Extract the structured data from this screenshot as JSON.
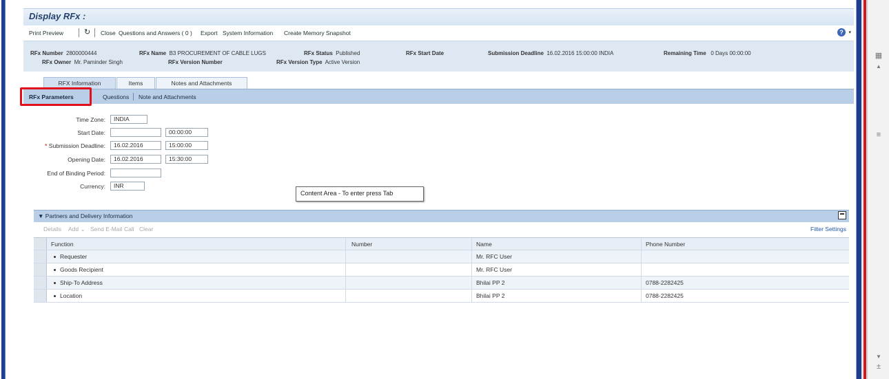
{
  "title": "Display RFx :",
  "toolbar": {
    "print_preview": "Print Preview",
    "refresh_icon": "refresh-icon",
    "close": "Close",
    "questions_answers": "Questions and Answers ( 0 )",
    "export": "Export",
    "system_information": "System Information",
    "create_memory_snapshot": "Create Memory Snapshot",
    "help_icon": "help-icon"
  },
  "header": {
    "rfx_number_label": "RFx Number",
    "rfx_number_value": "2800000444",
    "rfx_name_label": "RFx Name",
    "rfx_name_value": "B3 PROCUREMENT OF CABLE LUGS",
    "rfx_status_label": "RFx Status",
    "rfx_status_value": "Published",
    "rfx_start_date_label": "RFx Start Date",
    "submission_deadline_label": "Submission Deadline",
    "submission_deadline_value": "16.02.2016 15:00:00 INDIA",
    "remaining_time_label": "Remaining Time",
    "remaining_time_value": "0 Days 00:00:00",
    "rfx_owner_label": "RFx Owner",
    "rfx_owner_value": "Mr. Paminder Singh",
    "rfx_version_number_label": "RFx Version Number",
    "rfx_version_type_label": "RFx Version Type",
    "rfx_version_type_value": "Active Version"
  },
  "main_tabs": [
    {
      "label": "RFX Information",
      "active": true
    },
    {
      "label": "Items",
      "active": false
    },
    {
      "label": "Notes and Attachments",
      "active": false
    }
  ],
  "sub_tabs": [
    {
      "label": "RFx Parameters",
      "active": true
    },
    {
      "label": "Questions",
      "active": false
    },
    {
      "label": "Note and Attachments",
      "active": false
    }
  ],
  "form": {
    "time_zone_label": "Time Zone:",
    "time_zone_value": "INDIA",
    "start_date_label": "Start Date:",
    "start_date_value": "",
    "start_time_value": "00:00:00",
    "submission_deadline_label": "Submission Deadline:",
    "submission_deadline_date": "16.02.2016",
    "submission_deadline_time": "15:00:00",
    "opening_date_label": "Opening Date:",
    "opening_date_value": "16.02.2016",
    "opening_time_value": "15:30:00",
    "end_binding_label": "End of Binding Period:",
    "end_binding_value": "",
    "currency_label": "Currency:",
    "currency_value": "INR",
    "required_mark": "*"
  },
  "tooltip": "Content Area - To enter press Tab",
  "partners": {
    "title": "Partners and Delivery Information",
    "toolbar": {
      "details": "Details",
      "add": "Add ⌄",
      "send_email": "Send E-Mail",
      "call": "Call",
      "clear": "Clear",
      "filter_settings": "Filter Settings"
    },
    "columns": [
      "Function",
      "Number",
      "Name",
      "Phone Number"
    ],
    "rows": [
      {
        "function": "Requester",
        "number": "",
        "name": "Mr. RFC User",
        "phone": ""
      },
      {
        "function": "Goods Recipient",
        "number": "",
        "name": "Mr. RFC User",
        "phone": ""
      },
      {
        "function": "Ship-To Address",
        "number": "",
        "name": "Bhilai PP 2",
        "phone": "0788-2282425"
      },
      {
        "function": "Location",
        "number": "",
        "name": "Bhilai PP 2",
        "phone": "0788-2282425"
      }
    ]
  },
  "colors": {
    "frame_blue": "#1e3d8e",
    "highlight_red": "#e10e1b",
    "tab_bar": "#b9cfe8",
    "header_bg": "#dde8f3"
  }
}
